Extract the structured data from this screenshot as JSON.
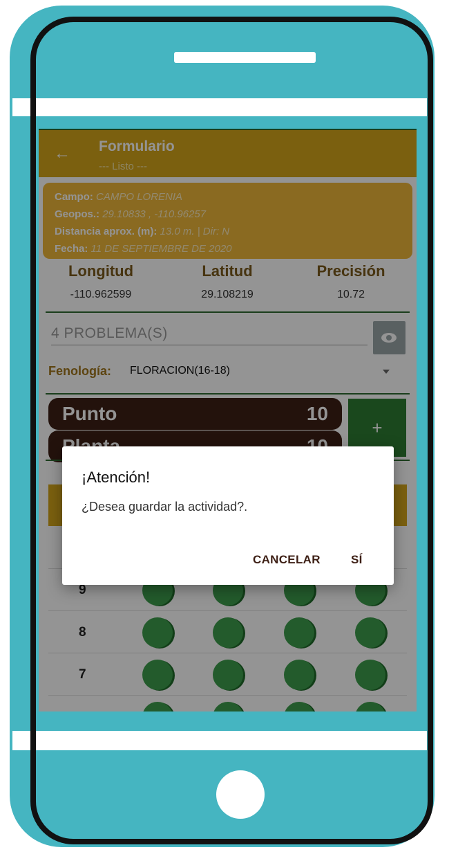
{
  "app_bar": {
    "title": "Formulario",
    "subtitle": "--- Listo ---"
  },
  "info_card": {
    "campo_label": "Campo:",
    "campo_value": "CAMPO LORENIA",
    "geopos_label": "Geopos.:",
    "geopos_value": "29.10833 , -110.96257",
    "distancia_label": "Distancia aprox. (m):",
    "distancia_value": "13.0 m. | Dir: N",
    "fecha_label": "Fecha:",
    "fecha_value": "11 DE SEPTIEMBRE DE 2020"
  },
  "coords": {
    "longitud_label": "Longitud",
    "longitud_value": "-110.962599",
    "latitud_label": "Latitud",
    "latitud_value": "29.108219",
    "precision_label": "Precisión",
    "precision_value": "10.72"
  },
  "problems_field": "4 PROBLEMA(S)",
  "icons": {
    "back": "arrow-back-icon",
    "eye": "eye-icon",
    "dropdown": "dropdown-arrow-icon",
    "add": "plus-icon"
  },
  "fenologia": {
    "label": "Fenología:",
    "value": "FLORACION(16-18)"
  },
  "counters": {
    "punto_label": "Punto",
    "punto_value": "10",
    "planta_label": "Planta",
    "planta_value": "10",
    "add_button": "+"
  },
  "grid_rows": [
    {
      "number": "9"
    },
    {
      "number": "8"
    },
    {
      "number": "7"
    }
  ],
  "dialog": {
    "title": "¡Atención!",
    "message": "¿Desea guardar la actividad?.",
    "cancel_button": "CANCELAR",
    "confirm_button": "SÍ"
  },
  "colors": {
    "teal": "#45b5c1",
    "gold": "#d4a51a",
    "green": "#2e7d32",
    "brown": "#3d1f15"
  }
}
